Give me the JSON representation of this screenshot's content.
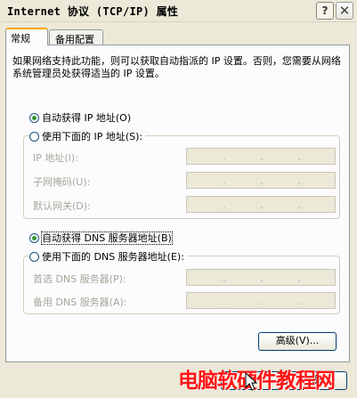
{
  "window": {
    "title": "Internet 协议 (TCP/IP) 属性",
    "help_label": "?",
    "close_label": "✕"
  },
  "tabs": [
    {
      "label": "常规",
      "active": true
    },
    {
      "label": "备用配置",
      "active": false
    }
  ],
  "info_text": "如果网络支持此功能，则可以获取自动指派的 IP 设置。否则，您需要从网络系统管理员处获得适当的 IP 设置。",
  "ip_section": {
    "auto_label": "自动获得 IP 地址(O)",
    "auto_checked": true,
    "manual_label": "使用下面的 IP 地址(S):",
    "manual_checked": false,
    "fields": [
      {
        "label": "IP 地址(I):",
        "value": ""
      },
      {
        "label": "子网掩码(U):",
        "value": ""
      },
      {
        "label": "默认网关(D):",
        "value": ""
      }
    ]
  },
  "dns_section": {
    "auto_label": "自动获得 DNS 服务器地址(B)",
    "auto_checked": true,
    "manual_label": "使用下面的 DNS 服务器地址(E):",
    "manual_checked": false,
    "fields": [
      {
        "label": "首选 DNS 服务器(P):",
        "value": ""
      },
      {
        "label": "备用 DNS 服务器(A):",
        "value": ""
      }
    ]
  },
  "advanced_button": "高级(V)...",
  "ok_button": "确",
  "cancel_button": "取",
  "watermark": "电脑软硬件教程网",
  "colors": {
    "dialog_bg": "#ece9d8",
    "panel_bg": "#fcfcfe",
    "tab_highlight": "#f7a400",
    "radio_dot": "#2f9a2f",
    "watermark": "#ff1515"
  }
}
